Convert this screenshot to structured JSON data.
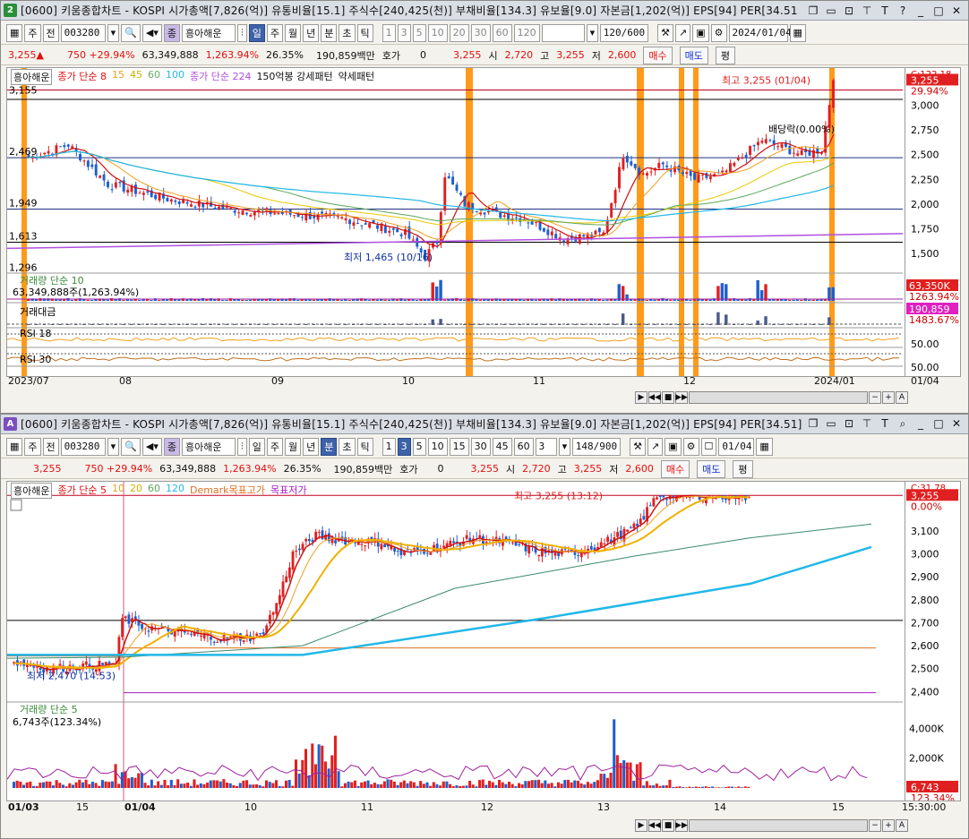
{
  "w1": {
    "num": "2",
    "num_color": "#2a8f3a",
    "title": "[0600] 키움종합차트 - KOSPI 시가총액[7,826(억)] 유통비율[15.1] 주식수[240,425(천)] 부채비율[134.3] 유보율[9.0] 자본금[1,202(억)] EPS[94] PER[34.51",
    "code": "003280",
    "name": "흥아해운",
    "period_sel": "일",
    "periods": [
      "일",
      "주",
      "월",
      "년",
      "분",
      "초",
      "틱"
    ],
    "mins": [
      "1",
      "3",
      "5",
      "10",
      "20",
      "30",
      "60",
      "120"
    ],
    "count": "120/600",
    "date": "2024/01/04",
    "quote": {
      "price": "3,255",
      "arrow": "▲",
      "chg": "750 +29.94%",
      "vol": "63,349,888",
      "volpct": "1,263.94%",
      "turn": "26.35%",
      "amt": "190,859백만",
      "hoga": "호가",
      "hoga_v": "0",
      "cur": "3,255",
      "open_l": "시",
      "open": "2,720",
      "high_l": "고",
      "high": "3,255",
      "low_l": "저",
      "low": "2,600",
      "buy": "매수",
      "sell": "매도",
      "eval": "평"
    },
    "legend": {
      "name": "흥아해운",
      "ma_label": "종가 단순 8",
      "ma": [
        "15",
        "45",
        "60",
        "100"
      ],
      "ma2": "종가 단순 224",
      "pat": "150억봉 강세패턴",
      "weak": "약세패턴"
    },
    "axis_ticks": [
      "3,000",
      "2,750",
      "2,500",
      "2,250",
      "2,000",
      "1,750",
      "1,500"
    ],
    "axis_top": "C:122.18",
    "axis_price": "3,255",
    "axis_pct": "29.94%",
    "left_levels": [
      "3,155",
      "2,469",
      "1,949",
      "1,613",
      "1,296"
    ],
    "ann_high": "최고 3,255 (01/04)",
    "ann_low": "최저 1,465 (10/16)",
    "ann_div": "배당락(0.00%)",
    "vol_label": "거래량 단순 10",
    "vol_value": "63,349,888주(1,263.94%)",
    "vol_axis": "63,350K",
    "vol_axis_pct": "1263.94%",
    "amt_label": "거래대금",
    "amt_axis": "190,859",
    "amt_axis_pct": "1483.67%",
    "rsi1": "RSI 18",
    "rsi2": "RSI 30",
    "rsi_axis": "50.00",
    "x_labels": [
      "2023/07",
      "08",
      "09",
      "10",
      "11",
      "12",
      "2024/01"
    ],
    "x_end": "01/04"
  },
  "w2": {
    "num": "A",
    "num_color": "#7a4fc0",
    "title": "[0600] 키움종합차트 - KOSPI 시가총액[7,826(억)] 유통비율[15.1] 주식수[240,425(천)] 부채비율[134.3] 유보율[9.0] 자본금[1,202(억)] EPS[94] PER[34.51]",
    "code": "003280",
    "name": "흥아해운",
    "period_sel": "3",
    "periods": [
      "일",
      "주",
      "월",
      "년",
      "분",
      "초",
      "틱"
    ],
    "mins": [
      "1",
      "3",
      "5",
      "10",
      "15",
      "30",
      "45",
      "60"
    ],
    "count_a": "3",
    "count": "148/900",
    "date": "01/04",
    "legend": {
      "name": "흥아해운",
      "ma_label": "종가 단순 5",
      "ma": [
        "10",
        "20",
        "60",
        "120"
      ],
      "demark": "Demark목표고가",
      "demark_low": "목표저가"
    },
    "axis_ticks": [
      "3,100",
      "3,000",
      "2,900",
      "2,800",
      "2,700",
      "2,600",
      "2,500",
      "2,400"
    ],
    "axis_top": "C:31.78",
    "axis_price": "3,255",
    "axis_pct": "0.00%",
    "ann_high": "최고 3,255 (13:12)",
    "ann_low": "최저 2,470 (14:53)",
    "vol_label": "거래량 단순 5",
    "vol_value": "6,743주(123.34%)",
    "vol_axis": [
      "4,000K",
      "2,000K"
    ],
    "vol_axis_cur": "6,743",
    "vol_axis_pct": "123.34%",
    "x_labels": [
      "01/03",
      "15",
      "01/04",
      "10",
      "11",
      "12",
      "13",
      "14",
      "15"
    ],
    "x_end": "15:30:00"
  },
  "colors": {
    "up": "#e02020",
    "down": "#1e5fd0",
    "hl": "#ff9a1a",
    "ma_red": "#d01010",
    "ma_orange": "#f0a020",
    "ma_yellow": "#e8c800",
    "ma_green": "#5aa85a",
    "ma_cyan": "#22b8e8",
    "ma_purple": "#b050e0"
  }
}
